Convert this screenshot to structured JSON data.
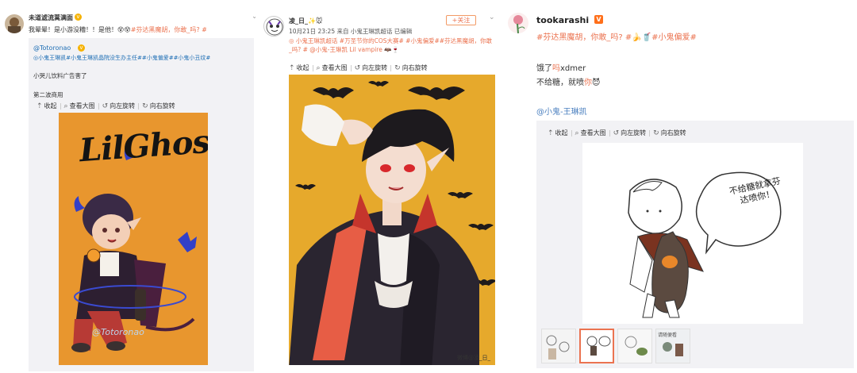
{
  "toolbar": {
    "collapse": "收起",
    "view_large": "查看大图",
    "rotate_left": "向左旋转",
    "rotate_right": "向右旋转"
  },
  "post1": {
    "username": "未道滤流蒿满面",
    "text_main": "我晕晕！是小游没糟！！是他！",
    "text_emoji": "😵😵",
    "text_tag": "#芬达黑魔胡，你敢_吗?",
    "text_hash": " #",
    "repost": {
      "username": "@Totoronao",
      "tags": "◎小鬼王琳凯#小鬼王琳凯晶院没生办主任##小鬼偏爱##小鬼小丑纹#",
      "line1": "小哭儿饮料广告害了",
      "line2": "第二波商用"
    },
    "art_title": "LilGhost",
    "watermark": "@Totoronao"
  },
  "post2": {
    "username": "凌_日_",
    "name_emoji": "✨🐭",
    "follow": "+关注",
    "meta": "10月21日 23:25 来自 小鬼王琳凯超话 已编辑",
    "tags": "◎ 小鬼王琳凯超话 #万圣节你的COS大赛# #小鬼偏爱##芬达黑魔胡，你敢_吗? # @小鬼-王琳凯 Lil vampire 🦇🍷",
    "watermark": "微博@凌_日_"
  },
  "post3": {
    "username": "tookarashi",
    "badge": "V",
    "tag_line": "#芬达黑魔胡，你敢_吗? #🍌🥤#小鬼偏爱#",
    "line1_pre": "饿了",
    "line1_link": "吗",
    "line1_post": "xdmer",
    "line2_pre": "不给糖，就喷",
    "line2_link": "你",
    "line2_emoji": "😈",
    "mention": "@小鬼-王琳凯",
    "bubble_text": "不给糖就拿芬达喷你！",
    "thumbs": [
      "thumb-1",
      "thumb-2",
      "thumb-3",
      "thumb-4"
    ],
    "thumb4_label": "请随便看"
  },
  "colors": {
    "orange_bg": "#e8962e",
    "yellow_bg": "#e6a92c",
    "link": "#eb7350",
    "blue": "#1f6fb5"
  }
}
